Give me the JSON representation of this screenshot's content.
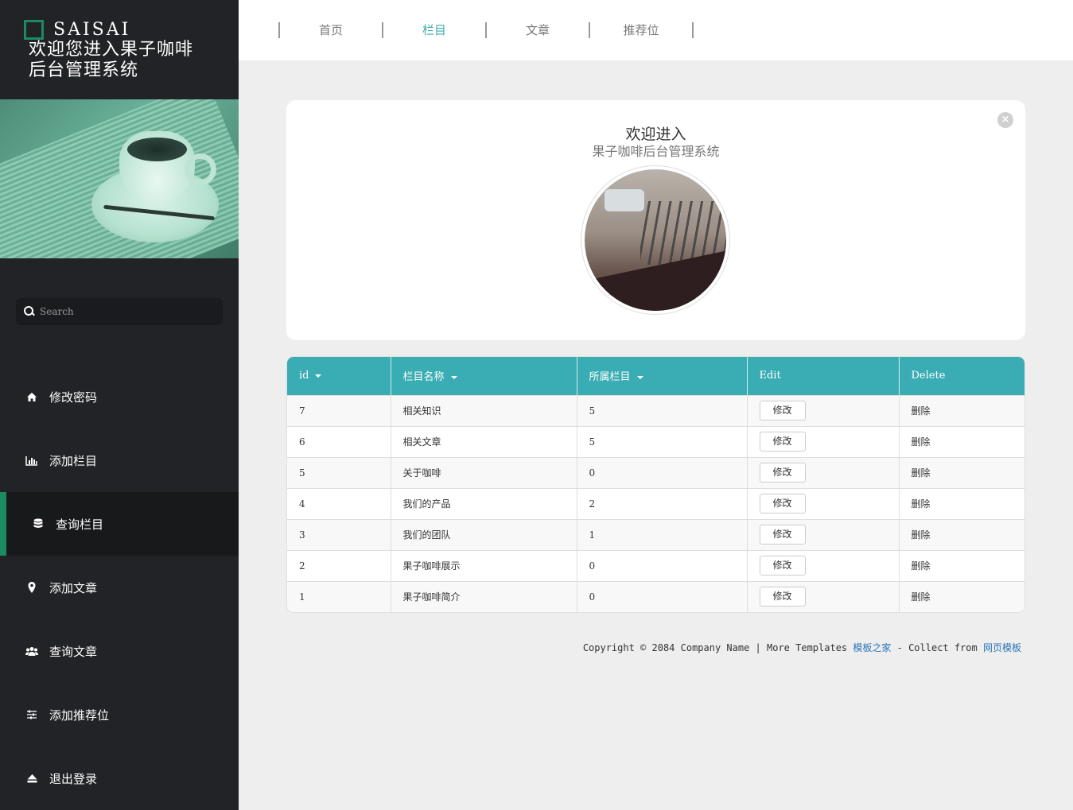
{
  "brand": {
    "name": "SAISAI",
    "welcome_line1": "欢迎您进入果子咖啡",
    "welcome_line2": "后台管理系统"
  },
  "search": {
    "placeholder": "Search"
  },
  "sidebar": {
    "items": [
      {
        "label": "修改密码",
        "icon": "home-icon",
        "active": false
      },
      {
        "label": "添加栏目",
        "icon": "bar-chart-icon",
        "active": false
      },
      {
        "label": "查询栏目",
        "icon": "database-icon",
        "active": true
      },
      {
        "label": "添加文章",
        "icon": "map-pin-icon",
        "active": false
      },
      {
        "label": "查询文章",
        "icon": "users-icon",
        "active": false
      },
      {
        "label": "添加推荐位",
        "icon": "sliders-icon",
        "active": false
      },
      {
        "label": "退出登录",
        "icon": "eject-icon",
        "active": false
      }
    ]
  },
  "topnav": {
    "items": [
      {
        "label": "首页",
        "active": false
      },
      {
        "label": "栏目",
        "active": true
      },
      {
        "label": "文章",
        "active": false
      },
      {
        "label": "推荐位",
        "active": false
      }
    ]
  },
  "card": {
    "title": "欢迎进入",
    "subtitle": "果子咖啡后台管理系统",
    "close_label": "×"
  },
  "table": {
    "headers": {
      "id": "id",
      "name": "栏目名称",
      "parent": "所属栏目",
      "edit": "Edit",
      "delete": "Delete"
    },
    "rows": [
      {
        "id": "7",
        "name": "相关知识",
        "parent": "5",
        "edit": "修改",
        "delete": "删除"
      },
      {
        "id": "6",
        "name": "相关文章",
        "parent": "5",
        "edit": "修改",
        "delete": "删除"
      },
      {
        "id": "5",
        "name": "关于咖啡",
        "parent": "0",
        "edit": "修改",
        "delete": "删除"
      },
      {
        "id": "4",
        "name": "我们的产品",
        "parent": "2",
        "edit": "修改",
        "delete": "删除"
      },
      {
        "id": "3",
        "name": "我们的团队",
        "parent": "1",
        "edit": "修改",
        "delete": "删除"
      },
      {
        "id": "2",
        "name": "果子咖啡展示",
        "parent": "0",
        "edit": "修改",
        "delete": "删除"
      },
      {
        "id": "1",
        "name": "果子咖啡简介",
        "parent": "0",
        "edit": "修改",
        "delete": "删除"
      }
    ]
  },
  "footer": {
    "prefix": "Copyright © 2084 Company Name | More Templates ",
    "link1": "模板之家",
    "middle": " - Collect from ",
    "link2": "网页模板"
  },
  "colors": {
    "accent": "#3aacb3",
    "brand_green": "#1c8b62",
    "sidebar_bg": "#222327"
  }
}
